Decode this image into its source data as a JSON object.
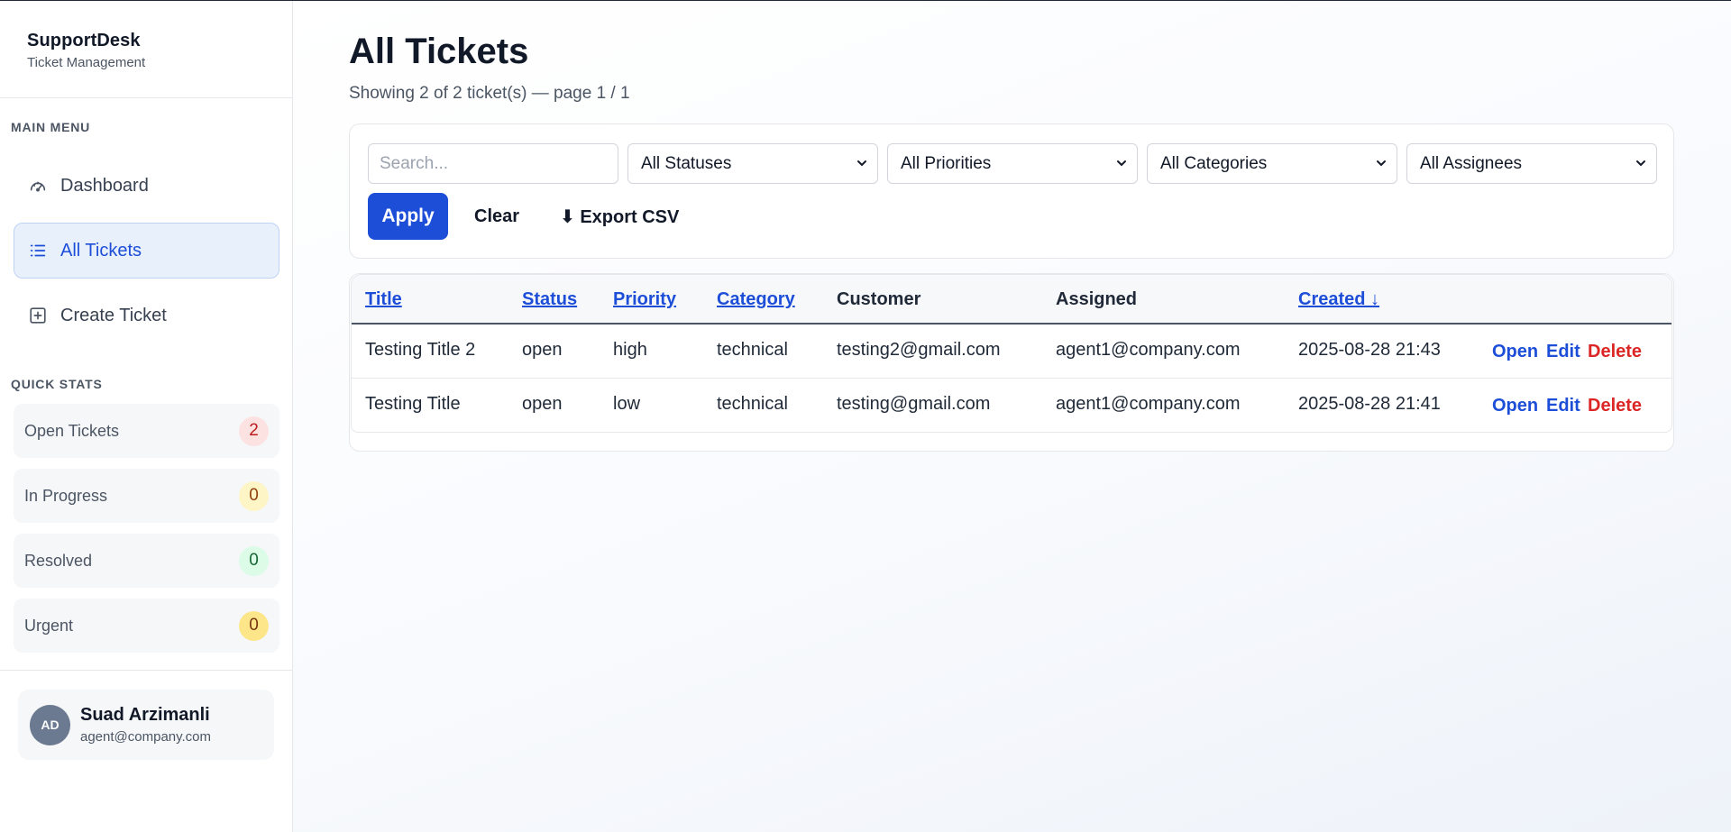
{
  "brand": {
    "name": "SupportDesk",
    "subtitle": "Ticket Management"
  },
  "sidebar": {
    "menu_label": "MAIN MENU",
    "items": [
      {
        "label": "Dashboard",
        "icon": "gauge-icon",
        "active": false
      },
      {
        "label": "All Tickets",
        "icon": "list-icon",
        "active": true
      },
      {
        "label": "Create Ticket",
        "icon": "plus-square-icon",
        "active": false
      }
    ],
    "stats_label": "QUICK STATS",
    "stats": [
      {
        "label": "Open Tickets",
        "count": "2",
        "color": "#b91c1c"
      },
      {
        "label": "In Progress",
        "count": "0",
        "color": "#92400e"
      },
      {
        "label": "Resolved",
        "count": "0",
        "color": "#166534"
      },
      {
        "label": "Urgent",
        "count": "0",
        "color": "#78350f"
      }
    ]
  },
  "user": {
    "initials": "AD",
    "name": "Suad Arzimanli",
    "email": "agent@company.com"
  },
  "page": {
    "title": "All Tickets",
    "subtitle": "Showing 2 of 2 ticket(s) — page 1 / 1"
  },
  "filters": {
    "search_placeholder": "Search...",
    "status": "All Statuses",
    "priority": "All Priorities",
    "category": "All Categories",
    "assignee": "All Assignees",
    "apply_label": "Apply",
    "clear_label": "Clear",
    "export_label": "⬇ Export CSV"
  },
  "table": {
    "columns": [
      "Title",
      "Status",
      "Priority",
      "Category",
      "Customer",
      "Assigned",
      "Created ↓"
    ],
    "rows": [
      {
        "title": "Testing Title 2",
        "status": "open",
        "priority": "high",
        "category": "technical",
        "customer": "testing2@gmail.com",
        "assigned": "agent1@company.com",
        "created": "2025-08-28 21:43"
      },
      {
        "title": "Testing Title",
        "status": "open",
        "priority": "low",
        "category": "technical",
        "customer": "testing@gmail.com",
        "assigned": "agent1@company.com",
        "created": "2025-08-28 21:41"
      }
    ],
    "actions": {
      "open": "Open",
      "edit": "Edit",
      "delete": "Delete"
    }
  },
  "colors": {
    "accent": "#1d4ed8",
    "danger": "#dc2626",
    "active_bg": "#e8f0fc"
  }
}
